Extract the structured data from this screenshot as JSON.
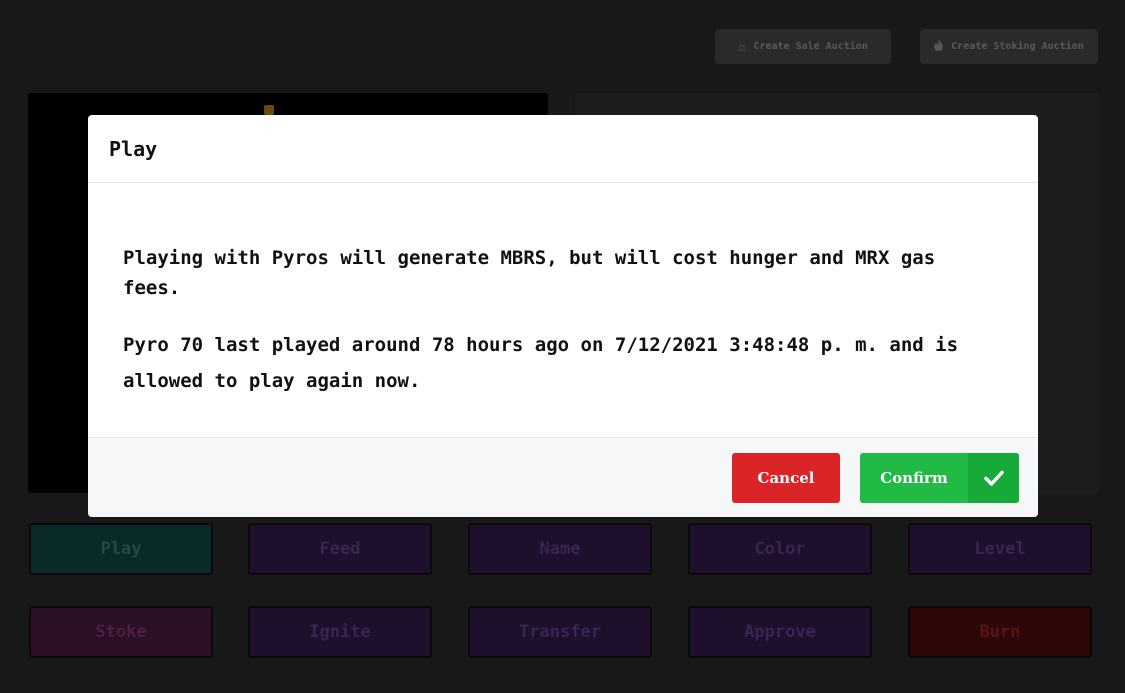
{
  "toolbar": {
    "sale_auction": {
      "label": "Create Sale Auction",
      "icon": "balance-scale-icon"
    },
    "stoking_auction": {
      "label": "Create Stoking Auction",
      "icon": "fire-icon"
    }
  },
  "actions": {
    "row1": [
      {
        "label": "Play",
        "bg": "#0a2a28",
        "color": "#1f4a45"
      },
      {
        "label": "Feed",
        "bg": "#1e0f2d",
        "color": "#3a2550"
      },
      {
        "label": "Name",
        "bg": "#1e0f2d",
        "color": "#3a2550"
      },
      {
        "label": "Color",
        "bg": "#1e0f2d",
        "color": "#3a2550"
      },
      {
        "label": "Level",
        "bg": "#1e0f2d",
        "color": "#3a2550"
      }
    ],
    "row2": [
      {
        "label": "Stoke",
        "bg": "#2a0f25",
        "color": "#4d1f43"
      },
      {
        "label": "Ignite",
        "bg": "#1e0f2d",
        "color": "#3a2550"
      },
      {
        "label": "Transfer",
        "bg": "#1e0f2d",
        "color": "#3a2550"
      },
      {
        "label": "Approve",
        "bg": "#1e0f2d",
        "color": "#3a2550"
      },
      {
        "label": "Burn",
        "bg": "#2e0808",
        "color": "#571414"
      }
    ]
  },
  "modal": {
    "title": "Play",
    "message_1": "Playing with Pyros will generate MBRS, but will cost hunger and MRX gas fees.",
    "message_2": "Pyro 70 last played around 78 hours ago on 7/12/2021 3:48:48 p. m. and is allowed to play again now.",
    "cancel_label": "Cancel",
    "confirm_label": "Confirm",
    "confirm_icon": "checkmark-icon"
  },
  "colors": {
    "cancel": "#db2428",
    "confirm": "#21ba45"
  }
}
